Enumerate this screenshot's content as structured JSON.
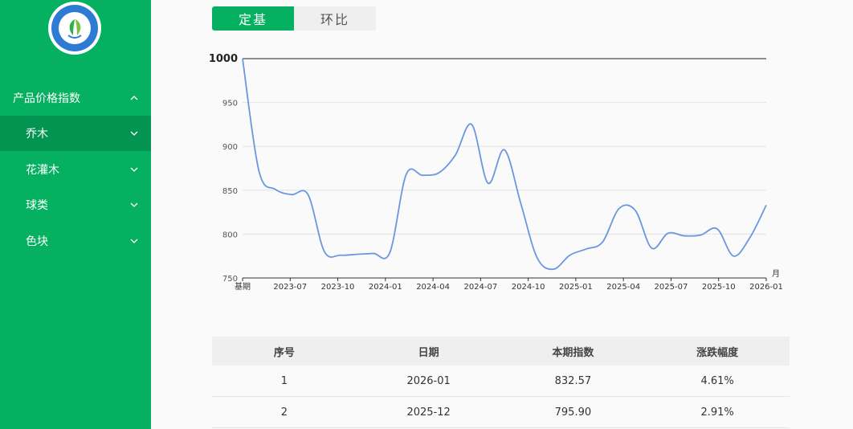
{
  "sidebar": {
    "section_label": "产品价格指数",
    "items": [
      {
        "label": "乔木",
        "active": true
      },
      {
        "label": "花灌木",
        "active": false
      },
      {
        "label": "球类",
        "active": false
      },
      {
        "label": "色块",
        "active": false
      }
    ],
    "colors": {
      "background": "#05b060",
      "active": "#039451"
    }
  },
  "tabs": [
    {
      "label": "定基",
      "active": true
    },
    {
      "label": "环比",
      "active": false
    }
  ],
  "chart_data": {
    "type": "line",
    "x_ticks": [
      "基期",
      "2023-07",
      "2023-10",
      "2024-01",
      "2024-04",
      "2024-07",
      "2024-10",
      "2025-01",
      "2025-04",
      "2025-07",
      "2025-10",
      "2026-01"
    ],
    "x_unit": "月",
    "ylim": [
      750,
      1000
    ],
    "y_ticks": [
      750,
      800,
      850,
      900,
      950,
      1000
    ],
    "grid": true,
    "line_color": "#6b96e0",
    "series": [
      {
        "values": [
          1000,
          872,
          851,
          845,
          845,
          780,
          776,
          777,
          778,
          779,
          868,
          867,
          870,
          890,
          925,
          858,
          896,
          835,
          773,
          760,
          776,
          783,
          791,
          829,
          827,
          784,
          801,
          798,
          799,
          806,
          775,
          796,
          833
        ]
      }
    ]
  },
  "table": {
    "headers": [
      "序号",
      "日期",
      "本期指数",
      "涨跌幅度"
    ],
    "rows": [
      [
        "1",
        "2026-01",
        "832.57",
        "4.61%"
      ],
      [
        "2",
        "2025-12",
        "795.90",
        "2.91%"
      ]
    ]
  }
}
